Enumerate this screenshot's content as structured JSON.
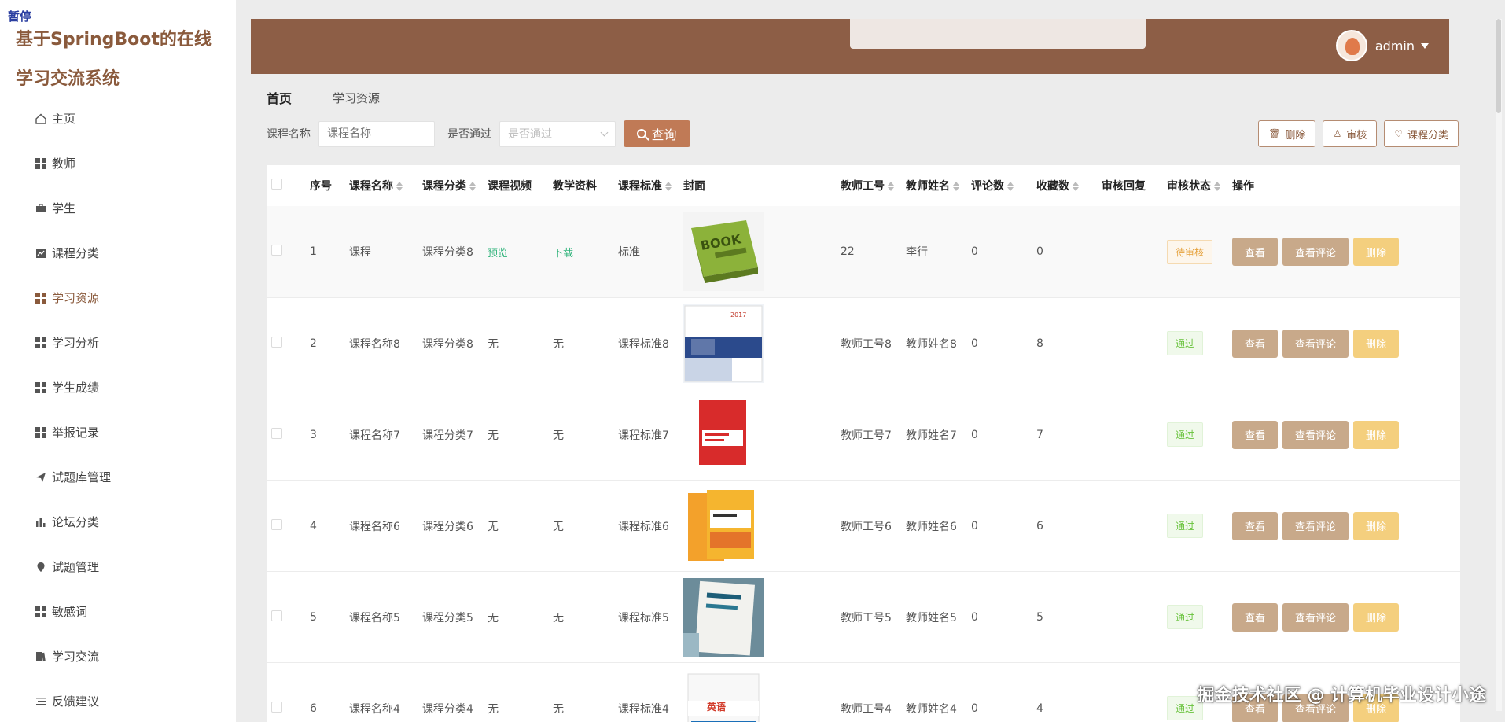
{
  "overlay": {
    "pause_label": "暂停"
  },
  "app": {
    "title": "基于SpringBoot的在线学习交流系统"
  },
  "sidebar": {
    "items": [
      {
        "label": "主页",
        "icon": "home-icon"
      },
      {
        "label": "教师",
        "icon": "grid-icon"
      },
      {
        "label": "学生",
        "icon": "briefcase-icon"
      },
      {
        "label": "课程分类",
        "icon": "chart-icon"
      },
      {
        "label": "学习资源",
        "icon": "grid-icon",
        "active": true
      },
      {
        "label": "学习分析",
        "icon": "grid-icon"
      },
      {
        "label": "学生成绩",
        "icon": "grid-icon"
      },
      {
        "label": "举报记录",
        "icon": "grid-icon"
      },
      {
        "label": "试题库管理",
        "icon": "send-icon"
      },
      {
        "label": "论坛分类",
        "icon": "bar-chart-icon"
      },
      {
        "label": "试题管理",
        "icon": "pin-icon"
      },
      {
        "label": "敏感词",
        "icon": "grid-icon"
      },
      {
        "label": "学习交流",
        "icon": "book-icon"
      },
      {
        "label": "反馈建议",
        "icon": "list-icon"
      }
    ]
  },
  "header": {
    "username": "admin"
  },
  "breadcrumb": {
    "home": "首页",
    "current": "学习资源"
  },
  "search": {
    "course_label": "课程名称",
    "course_placeholder": "课程名称",
    "pass_label": "是否通过",
    "pass_placeholder": "是否通过",
    "query_label": "查询"
  },
  "actions": {
    "delete": "删除",
    "audit": "审核",
    "category": "课程分类"
  },
  "table": {
    "headers": {
      "no": "序号",
      "name": "课程名称",
      "cat": "课程分类",
      "video": "课程视频",
      "mat": "教学资料",
      "std": "课程标准",
      "cover": "封面",
      "tno": "教师工号",
      "tname": "教师姓名",
      "cmt": "评论数",
      "fav": "收藏数",
      "reply": "审核回复",
      "status": "审核状态",
      "ops": "操作"
    },
    "ops": {
      "view": "查看",
      "comments": "查看评论",
      "delete": "删除"
    },
    "rows": [
      {
        "no": "1",
        "name": "课程",
        "cat": "课程分类8",
        "video": "预览",
        "mat": "下载",
        "std": "标准",
        "tno": "22",
        "tname": "李行",
        "cmt": "0",
        "fav": "0",
        "reply": "",
        "status": "待审核",
        "status_kind": "pending",
        "cover": "book"
      },
      {
        "no": "2",
        "name": "课程名称8",
        "cat": "课程分类8",
        "video": "无",
        "mat": "无",
        "std": "课程标准8",
        "tno": "教师工号8",
        "tname": "教师姓名8",
        "cmt": "0",
        "fav": "8",
        "reply": "",
        "status": "通过",
        "status_kind": "pass",
        "cover": "blue"
      },
      {
        "no": "3",
        "name": "课程名称7",
        "cat": "课程分类7",
        "video": "无",
        "mat": "无",
        "std": "课程标准7",
        "tno": "教师工号7",
        "tname": "教师姓名7",
        "cmt": "0",
        "fav": "7",
        "reply": "",
        "status": "通过",
        "status_kind": "pass",
        "cover": "red"
      },
      {
        "no": "4",
        "name": "课程名称6",
        "cat": "课程分类6",
        "video": "无",
        "mat": "无",
        "std": "课程标准6",
        "tno": "教师工号6",
        "tname": "教师姓名6",
        "cmt": "0",
        "fav": "6",
        "reply": "",
        "status": "通过",
        "status_kind": "pass",
        "cover": "orange"
      },
      {
        "no": "5",
        "name": "课程名称5",
        "cat": "课程分类5",
        "video": "无",
        "mat": "无",
        "std": "课程标准5",
        "tno": "教师工号5",
        "tname": "教师姓名5",
        "cmt": "0",
        "fav": "5",
        "reply": "",
        "status": "通过",
        "status_kind": "pass",
        "cover": "photo"
      },
      {
        "no": "6",
        "name": "课程名称4",
        "cat": "课程分类4",
        "video": "无",
        "mat": "无",
        "std": "课程标准4",
        "tno": "教师工号4",
        "tname": "教师姓名4",
        "cmt": "0",
        "fav": "4",
        "reply": "",
        "status": "通过",
        "status_kind": "pass",
        "cover": "english"
      }
    ]
  },
  "watermark": "掘金技术社区 @ 计算机毕业设计小途",
  "colors": {
    "header": "#8d5e46",
    "brand": "#8a5a3c",
    "query": "#c07a56",
    "op": "#c8a98a",
    "delete": "#f4cf7e"
  }
}
